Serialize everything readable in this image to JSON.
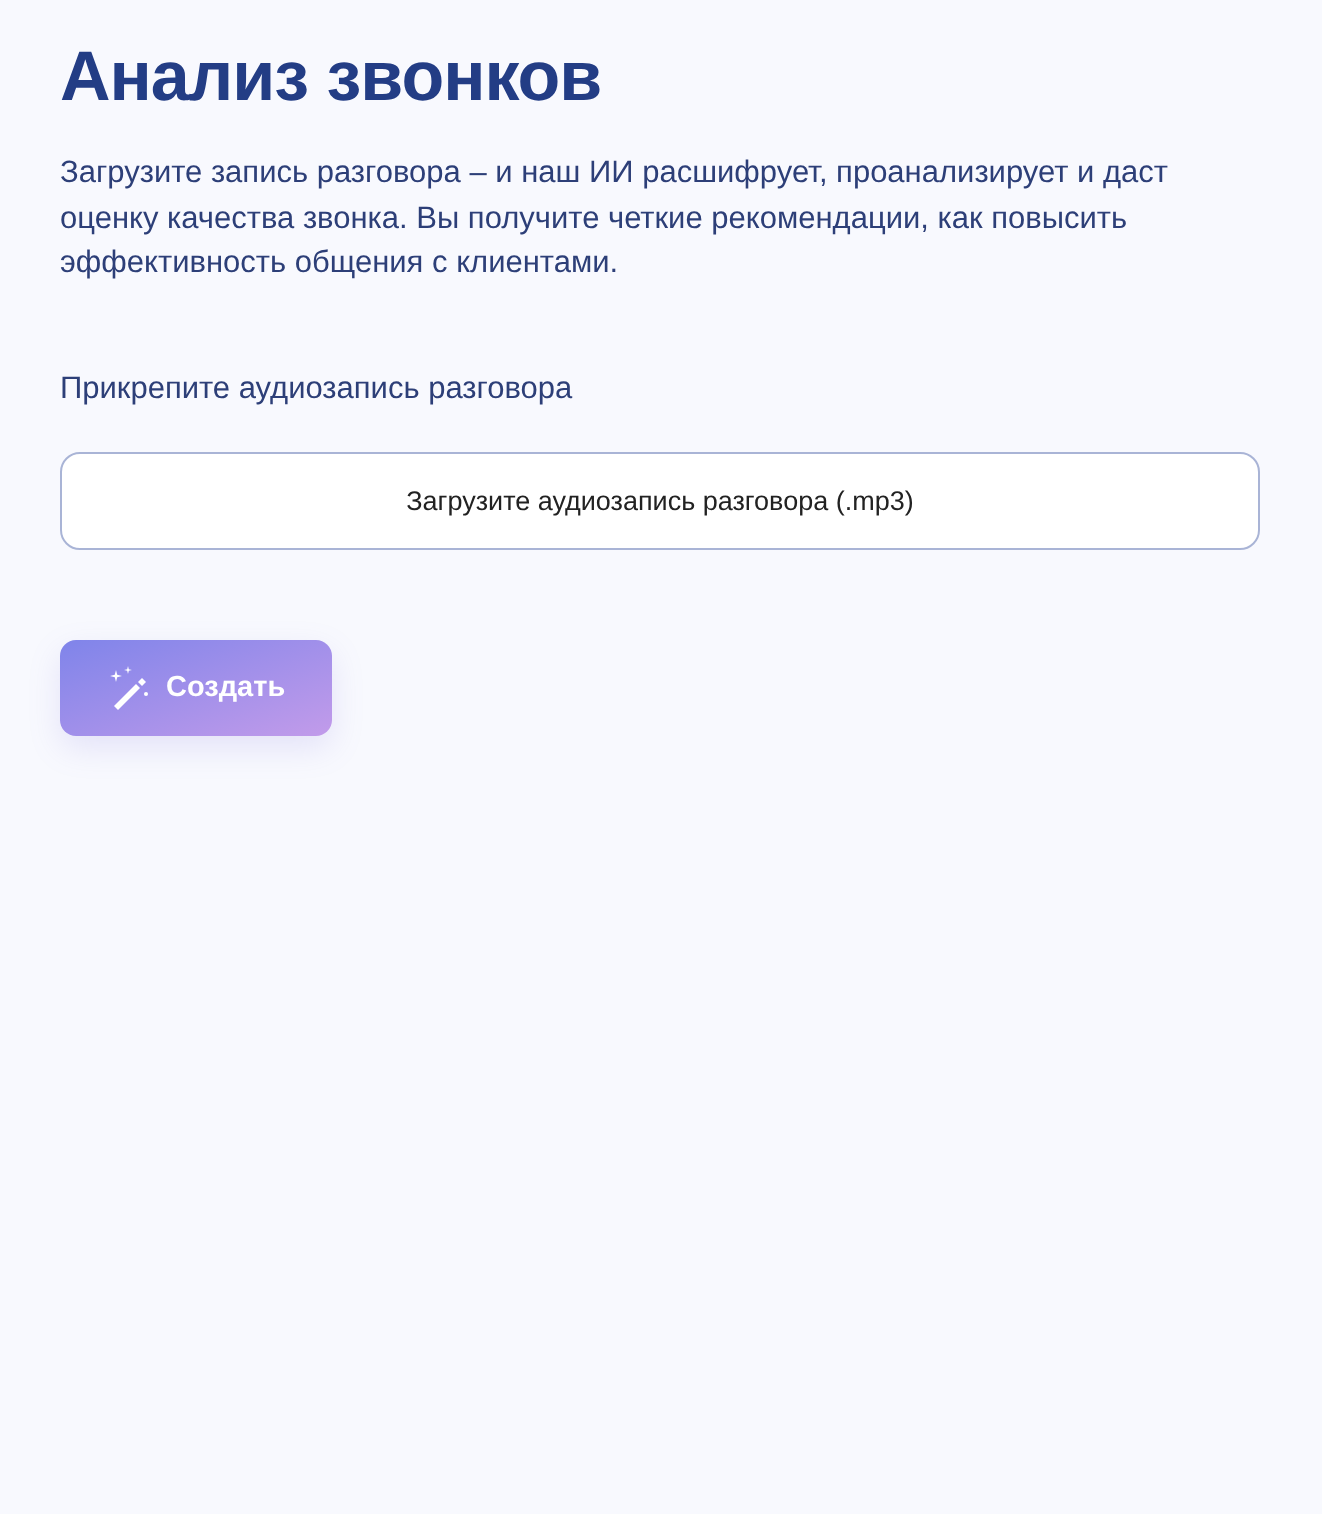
{
  "title": "Анализ звонков",
  "description": "Загрузите запись разговора – и наш ИИ расшифрует, проанализирует и даст оценку качества звонка. Вы получите четкие рекомендации, как повысить эффективность общения с клиентами.",
  "upload": {
    "label": "Прикрепите аудиозапись разговора",
    "button": "Загрузите аудиозапись разговора (.mp3)"
  },
  "submit": {
    "label": "Создать"
  }
}
